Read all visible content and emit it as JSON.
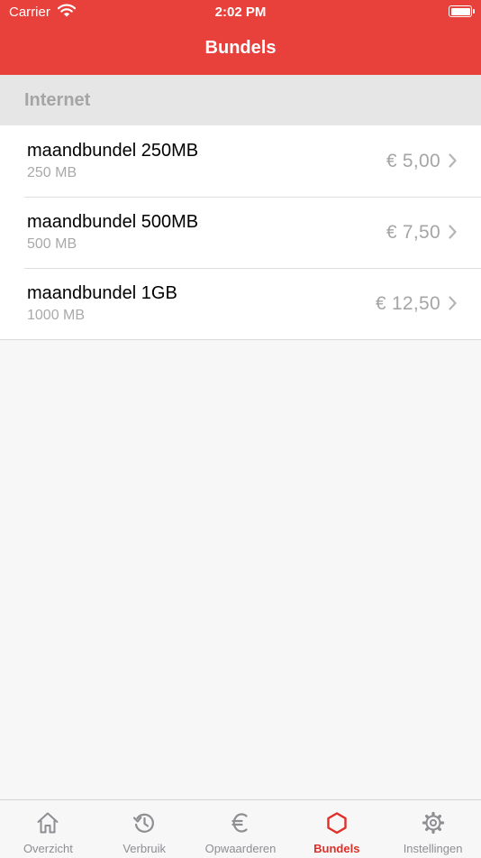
{
  "status_bar": {
    "carrier": "Carrier",
    "time": "2:02 PM"
  },
  "nav": {
    "title": "Bundels"
  },
  "section": {
    "title": "Internet"
  },
  "bundles": [
    {
      "name": "maandbundel 250MB",
      "size": "250 MB",
      "price": "€ 5,00"
    },
    {
      "name": "maandbundel 500MB",
      "size": "500 MB",
      "price": "€ 7,50"
    },
    {
      "name": "maandbundel 1GB",
      "size": "1000 MB",
      "price": "€ 12,50"
    }
  ],
  "tabs": [
    {
      "label": "Overzicht",
      "icon": "home-icon"
    },
    {
      "label": "Verbruik",
      "icon": "history-icon"
    },
    {
      "label": "Opwaarderen",
      "icon": "euro-icon"
    },
    {
      "label": "Bundels",
      "icon": "hexagon-icon",
      "active": true
    },
    {
      "label": "Instellingen",
      "icon": "gear-icon"
    }
  ],
  "colors": {
    "brand": "#e8403b",
    "tab_active": "#e02e28",
    "tab_inactive": "#8e8e93"
  }
}
